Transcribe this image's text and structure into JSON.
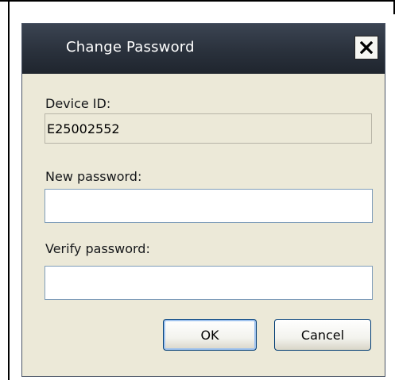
{
  "dialog": {
    "title": "Change Password",
    "close_icon": "close-icon"
  },
  "fields": {
    "device_id_label": "Device ID:",
    "device_id_value": "E25002552",
    "new_password_label": "New password:",
    "new_password_value": "",
    "verify_password_label": "Verify password:",
    "verify_password_value": ""
  },
  "buttons": {
    "ok_label": "OK",
    "cancel_label": "Cancel"
  },
  "colors": {
    "titlebar": "#2a313c",
    "dialog_background": "#ece9d8",
    "input_border": "#7f9db9"
  }
}
